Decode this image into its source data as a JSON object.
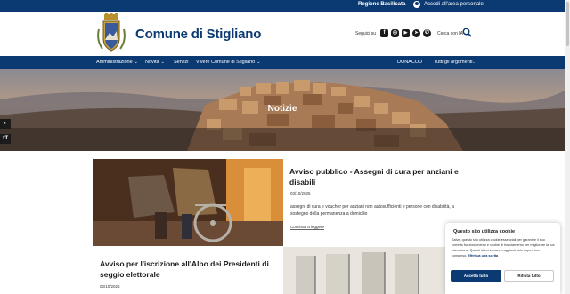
{
  "topbar": {
    "region_link": "Regione Basilicata",
    "login_link": "Accedi all'area personale"
  },
  "header": {
    "site_title": "Comune di Stigliano",
    "follow_label": "Seguici su",
    "socials": [
      "facebook-icon",
      "instagram-icon",
      "youtube-icon",
      "telegram-icon",
      "whatsapp-icon"
    ],
    "search_label": "Cerca con IA"
  },
  "nav": {
    "items": [
      {
        "label": "Amministrazione",
        "dropdown": true
      },
      {
        "label": "Novità",
        "dropdown": true
      },
      {
        "label": "Servizi",
        "dropdown": false
      },
      {
        "label": "Vivere Comune di Stigliano",
        "dropdown": true
      }
    ],
    "right_items": [
      "DONACOD",
      "Tutti gli argomenti..."
    ]
  },
  "hero": {
    "title": "Notizie"
  },
  "news": [
    {
      "title": "Avviso pubblico - Assegni di cura per anziani e disabili",
      "date": "03/10/2025",
      "text": "assegni di cura e voucher per anziani non autosufficienti e persone con disabilità, a sostegno della permanenza a domicilio",
      "more": "Continua a leggere"
    },
    {
      "title": "Avviso per l'iscrizione all'Albo dei Presidenti di seggio elettorale",
      "date": "02/10/2025"
    }
  ],
  "cookie": {
    "title": "Questo sito utilizza cookie",
    "text": "Salve, questo sito utilizza cookie essenziali per garantire il suo corretto funzionamento e cookie di tracciamento per migliorare la tua interazione. Questi ultimi verranno aggiunti solo dopo il tuo consenso.",
    "link": "Effettua una scelta",
    "accept": "Accetta tutto",
    "reject": "Rifiuta tutto"
  },
  "colors": {
    "brand": "#0b3a72"
  }
}
